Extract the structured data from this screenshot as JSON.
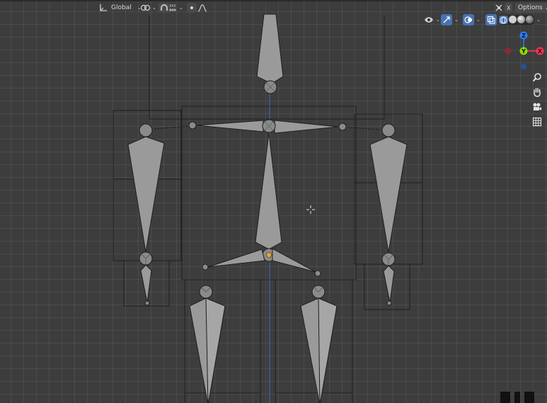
{
  "header": {
    "transform_orientation": "Global",
    "options_label": "Options",
    "close_glyph": "X"
  },
  "icons": {
    "orientation": "transform-orientation-icon",
    "pivot": "pivot-point-icon",
    "snap": "snap-icon",
    "snap_target": "snap-increment-icon",
    "proportional": "proportional-editing-icon",
    "falloff": "falloff-curve-icon",
    "visibility": "visibility-eye-icon",
    "gizmo": "gizmo-icon",
    "overlays": "overlays-icon",
    "xray": "xray-icon",
    "shading": [
      "wireframe-shading-icon",
      "solid-shading-icon",
      "material-preview-icon",
      "rendered-shading-icon"
    ],
    "navigation": [
      "zoom-icon",
      "pan-hand-icon",
      "camera-icon",
      "grid-view-icon"
    ]
  },
  "gizmo": {
    "axes": [
      {
        "label": "Z",
        "color": "#2a7fff"
      },
      {
        "label": "X",
        "color": "#ff3352"
      },
      {
        "label": "Y",
        "color": "#8bdc00"
      }
    ]
  },
  "colors": {
    "background": "#3d3d3d",
    "bone": "#9a9a9a",
    "bone_dark": "#7c7c7c",
    "outline": "#1e1e1e",
    "z_axis_line": "#3a6fb8"
  }
}
